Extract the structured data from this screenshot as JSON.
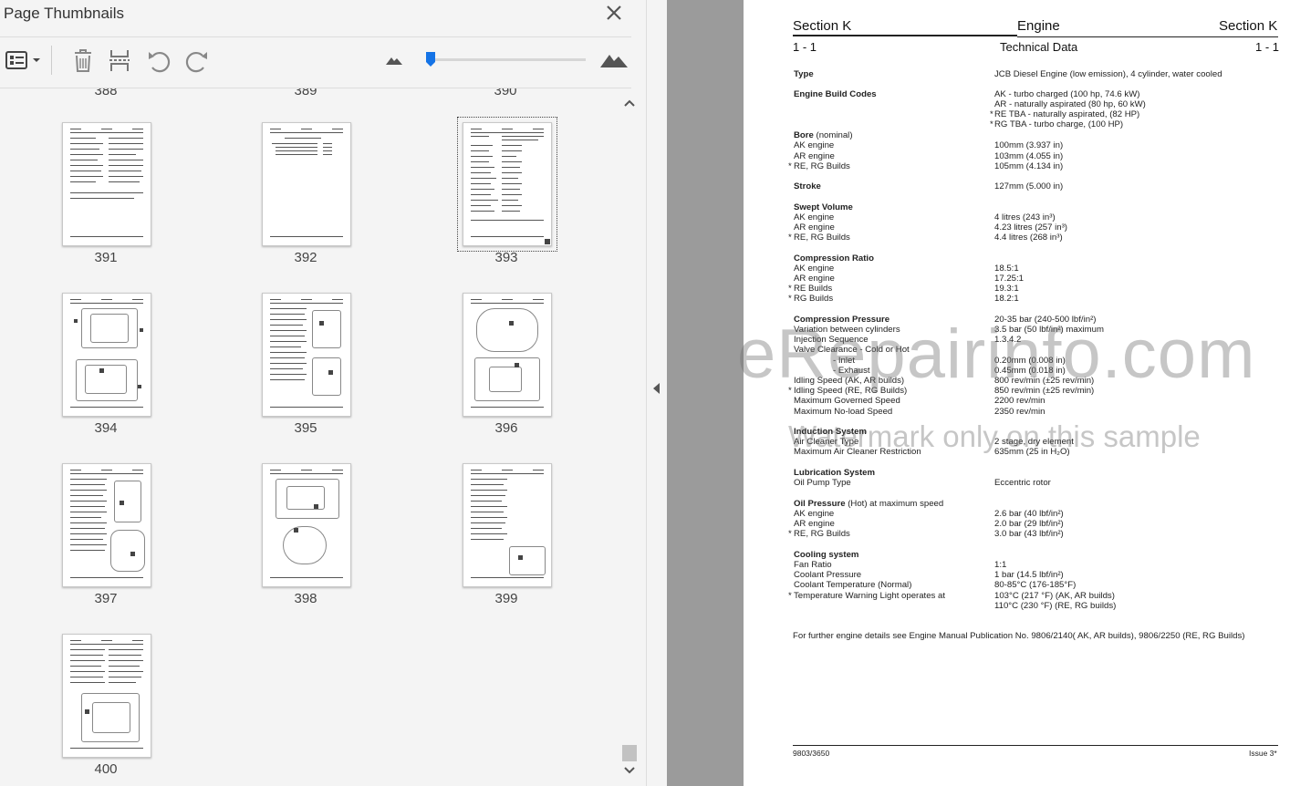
{
  "panel": {
    "title": "Page Thumbnails",
    "partial_labels": [
      "388",
      "389",
      "390"
    ],
    "thumbnails": [
      {
        "label": "391"
      },
      {
        "label": "392"
      },
      {
        "label": "393",
        "selected": true
      },
      {
        "label": "394"
      },
      {
        "label": "395"
      },
      {
        "label": "396"
      },
      {
        "label": "397"
      },
      {
        "label": "398"
      },
      {
        "label": "399"
      },
      {
        "label": "400"
      }
    ],
    "toolbar_icons": [
      "thumbnail-options-icon",
      "trash-icon",
      "insert-page-icon",
      "rotate-left-icon",
      "rotate-right-icon",
      "zoom-out-icon",
      "zoom-in-icon"
    ],
    "thumbnail_zoom_fraction": 0.03
  },
  "colors": {
    "accent": "#1473e6",
    "gutter": "#9b9b9b"
  },
  "document": {
    "header": {
      "left": "Section K",
      "center": "Engine",
      "right": "Section K"
    },
    "subheader": {
      "left": "1 - 1",
      "center": "Technical Data",
      "right": "1 - 1"
    },
    "rows": [
      {
        "label": "Type",
        "bold": true,
        "value": "JCB Diesel Engine (low emission), 4 cylinder, water cooled"
      },
      {
        "label": "Engine Build Codes",
        "bold": true,
        "value": "AK - turbo charged (100 hp, 74.6 kW)"
      },
      {
        "label": "",
        "value": "AR - naturally aspirated (80 hp, 60 kW)"
      },
      {
        "label": "",
        "value": "RE TBA - naturally aspirated, (82 HP)",
        "value_star": true
      },
      {
        "label": "",
        "value": "RG TBA - turbo charge, (100 HP)",
        "value_star": true
      },
      {
        "label": "Bore",
        "bold": true,
        "suffix": " (nominal)",
        "value": ""
      },
      {
        "label": "AK engine",
        "value": "100mm (3.937 in)"
      },
      {
        "label": "AR engine",
        "value": "103mm (4.055 in)"
      },
      {
        "label": "RE, RG Builds",
        "value": "105mm (4.134 in)",
        "star": true
      },
      {
        "label": "Stroke",
        "bold": true,
        "value": "127mm (5.000 in)"
      },
      {
        "label": "Swept Volume",
        "bold": true,
        "value": ""
      },
      {
        "label": "AK engine",
        "value": "4 litres (243 in³)"
      },
      {
        "label": "AR engine",
        "value": "4.23 litres (257 in³)"
      },
      {
        "label": "RE, RG Builds",
        "value": "4.4 litres (268 in³)",
        "star": true
      },
      {
        "label": "Compression Ratio",
        "bold": true,
        "value": ""
      },
      {
        "label": "AK engine",
        "value": "18.5:1"
      },
      {
        "label": "AR engine",
        "value": "17.25:1"
      },
      {
        "label": "RE Builds",
        "value": "19.3:1",
        "star": true
      },
      {
        "label": "RG Builds",
        "value": "18.2:1",
        "star": true
      },
      {
        "label": "Compression Pressure",
        "bold": true,
        "value": "20-35 bar (240-500 lbf/in²)"
      },
      {
        "label": "Variation between cylinders",
        "value": "3.5 bar (50 lbf/in²) maximum"
      },
      {
        "label": "Injection Sequence",
        "value": "1.3.4.2"
      },
      {
        "label": "Valve Clearance - Cold or Hot",
        "value": ""
      },
      {
        "label": "- Inlet",
        "indent": true,
        "value": "0.20mm (0.008 in)"
      },
      {
        "label": "- Exhaust",
        "indent": true,
        "value": "0.45mm (0.018 in)"
      },
      {
        "label": "Idling Speed (AK, AR builds)",
        "value": "800 rev/min (±25 rev/min)"
      },
      {
        "label": "Idling Speed (RE, RG Builds)",
        "value": "850 rev/min (±25 rev/min)",
        "star": true
      },
      {
        "label": "Maximum Governed Speed",
        "value": "2200 rev/min"
      },
      {
        "label": "Maximum No-load Speed",
        "value": "2350 rev/min"
      },
      {
        "label": "Induction System",
        "bold": true,
        "value": ""
      },
      {
        "label": "Air Cleaner Type",
        "value": "2 stage, dry element"
      },
      {
        "label": "Maximum Air Cleaner Restriction",
        "value": "635mm (25 in H₂O)"
      },
      {
        "label": "Lubrication System",
        "bold": true,
        "value": ""
      },
      {
        "label": "Oil Pump Type",
        "value": "Eccentric rotor"
      },
      {
        "label": "Oil Pressure",
        "bold": true,
        "suffix": " (Hot) at maximum speed",
        "value": ""
      },
      {
        "label": "AK engine",
        "value": "2.6 bar (40 lbf/in²)"
      },
      {
        "label": "AR engine",
        "value": "2.0 bar (29 lbf/in²)"
      },
      {
        "label": "RE, RG Builds",
        "value": "3.0 bar (43 lbf/in²)",
        "star": true
      },
      {
        "label": "Cooling system",
        "bold": true,
        "value": ""
      },
      {
        "label": "Fan Ratio",
        "value": "1:1"
      },
      {
        "label": "Coolant Pressure",
        "value": "1 bar (14.5 lbf/in²)"
      },
      {
        "label": "Coolant Temperature (Normal)",
        "value": "80-85°C (176-185°F)"
      },
      {
        "label": "Temperature Warning Light operates at",
        "value": "103°C (217 °F) (AK, AR builds)",
        "star": true
      },
      {
        "label": "",
        "value": "110°C (230 °F) (RE, RG builds)"
      }
    ],
    "note": "For further engine details see Engine Manual Publication No. 9806/2140( AK, AR builds), 9806/2250 (RE, RG Builds)",
    "footer": {
      "left": "9803/3650",
      "right": "Issue 3*"
    },
    "star_mark": "*"
  },
  "watermark": {
    "line1": "eRepairinfo.com",
    "line2": "Watermark only on this sample"
  }
}
